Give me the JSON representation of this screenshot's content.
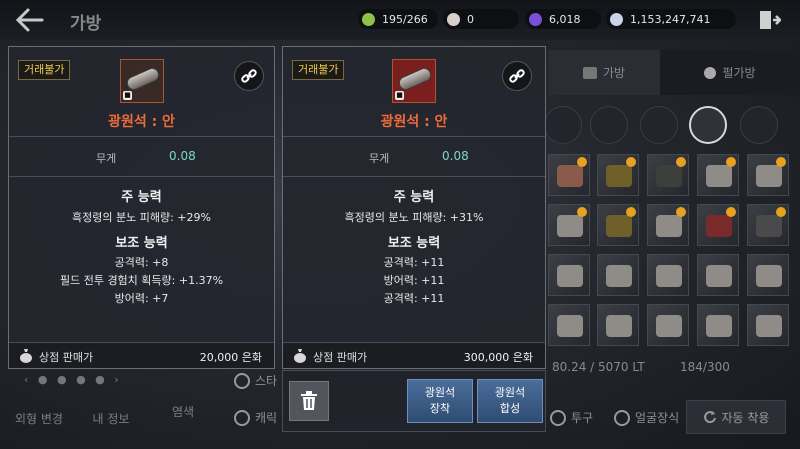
{
  "header": {
    "title": "가방",
    "resources": [
      {
        "name": "weight",
        "value": "195/266",
        "icon": "shield-coin-icon",
        "color": "#8fc24a"
      },
      {
        "name": "pearl",
        "value": "0",
        "icon": "pearl-icon",
        "color": "#d8d0c8"
      },
      {
        "name": "crystal",
        "value": "6,018",
        "icon": "crystal-icon",
        "color": "#7a4fd6"
      },
      {
        "name": "silver",
        "value": "1,153,247,741",
        "icon": "silver-coin-icon",
        "color": "#c9d3e6"
      }
    ]
  },
  "inventory": {
    "tabs": [
      "가방",
      "펄가방"
    ],
    "weight_text": "80.24 / 5070 LT",
    "slot_count_text": "184/300",
    "auto_equip_label": "자동 착용",
    "checkbox_labels": [
      "스타",
      "캐릭",
      "투구",
      "얼굴장식"
    ]
  },
  "left_bottom": {
    "buttons": [
      "외형 변경",
      "내 정보",
      "염색"
    ]
  },
  "tooltips": [
    {
      "badge": "거래불가",
      "item_name": "광원석 : 안",
      "weight_label": "무게",
      "weight_value": "0.08",
      "main_title": "주 능력",
      "main_stats": [
        "흑정령의 분노 피해량: +29%"
      ],
      "sub_title": "보조 능력",
      "sub_stats": [
        "공격력: +8",
        "필드 전투 경험치 획득량: +1.37%",
        "방어력: +7"
      ],
      "sell_label": "상점 판매가",
      "sell_value": "20,000 은화"
    },
    {
      "badge": "거래불가",
      "item_name": "광원석 : 안",
      "weight_label": "무게",
      "weight_value": "0.08",
      "main_title": "주 능력",
      "main_stats": [
        "흑정령의 분노 피해량: +31%"
      ],
      "sub_title": "보조 능력",
      "sub_stats": [
        "공격력: +11",
        "방어력: +11",
        "공격력: +11"
      ],
      "sell_label": "상점 판매가",
      "sell_value": "300,000 은화"
    }
  ],
  "actions": {
    "equip_line1": "광원석",
    "equip_line2": "장착",
    "combine_line1": "광원석",
    "combine_line2": "합성"
  },
  "colors": {
    "item_name": "#f06b3a",
    "weight_value": "#7ed6c9",
    "badge_text": "#f0c94a",
    "action_button": "#3f6190"
  }
}
